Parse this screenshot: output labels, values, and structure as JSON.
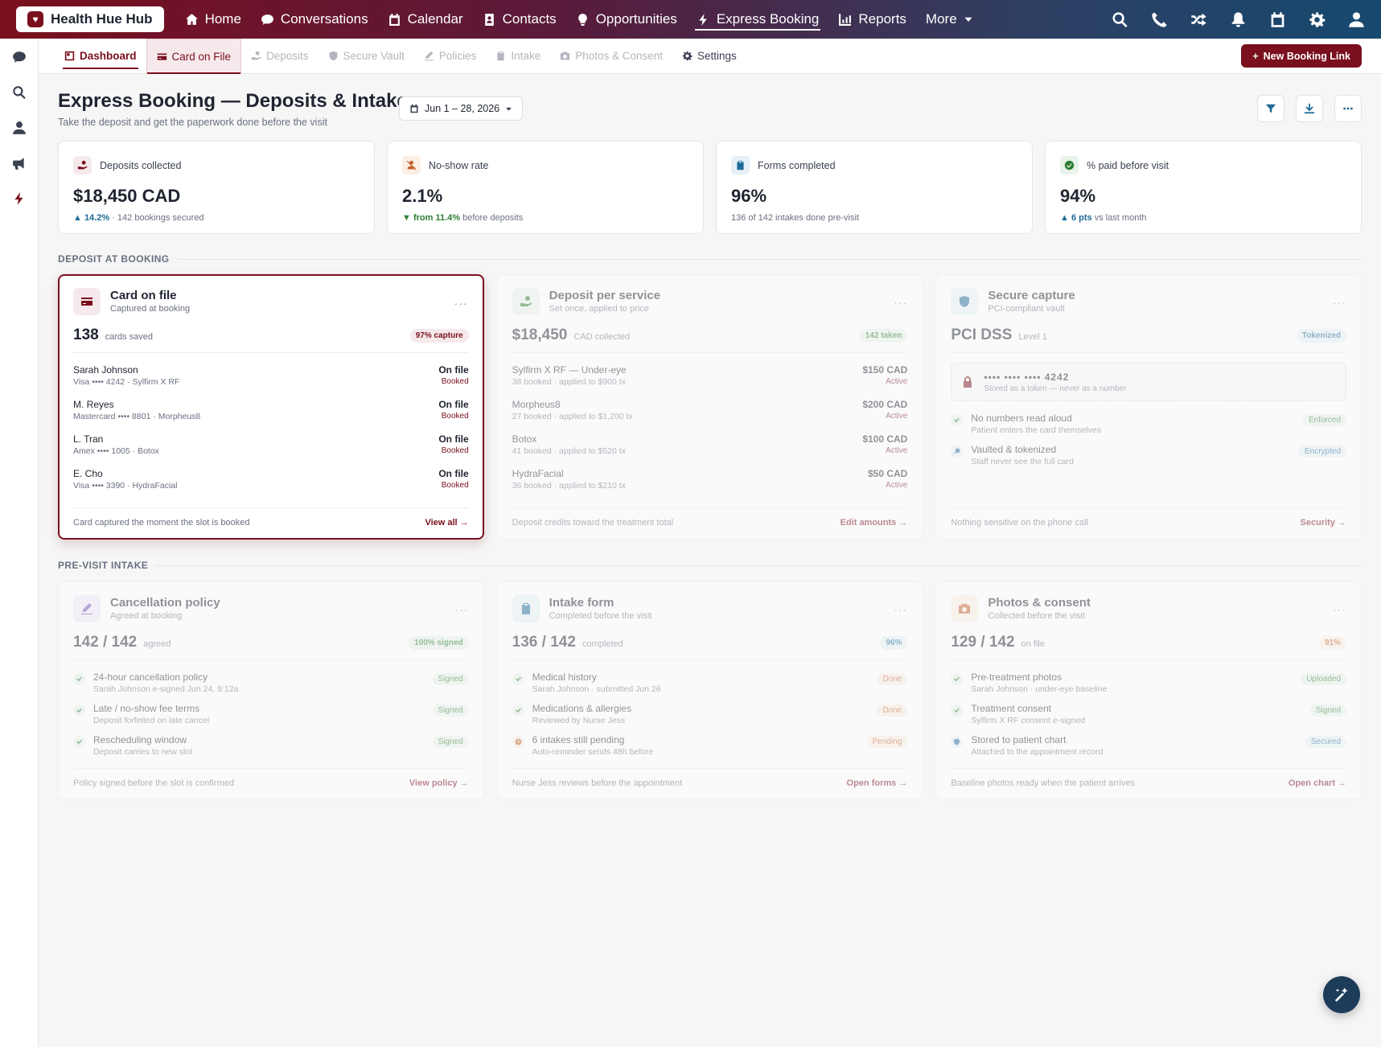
{
  "app": {
    "name": "Health Hue Hub"
  },
  "nav": {
    "items": [
      {
        "label": "Home",
        "icon": "home-icon"
      },
      {
        "label": "Conversations",
        "icon": "chat-icon"
      },
      {
        "label": "Calendar",
        "icon": "calendar-icon"
      },
      {
        "label": "Contacts",
        "icon": "contacts-icon"
      },
      {
        "label": "Opportunities",
        "icon": "lightbulb-icon"
      },
      {
        "label": "Express Booking",
        "icon": "bolt-icon",
        "active": true
      },
      {
        "label": "Reports",
        "icon": "bar-chart-icon"
      },
      {
        "label": "More",
        "icon": "caret-down-icon"
      }
    ],
    "right_icons": [
      "search-icon",
      "phone-icon",
      "shuffle-icon",
      "bell-icon",
      "calendar-icon",
      "gear-icon",
      "user-icon"
    ]
  },
  "rail": {
    "icons": [
      "chat-icon",
      "search-icon",
      "user-icon",
      "megaphone-icon",
      "bolt-icon"
    ]
  },
  "subnav": {
    "items": [
      {
        "label": "Dashboard",
        "icon": "dashboard-icon"
      },
      {
        "label": "Card on File",
        "icon": "card-icon"
      },
      {
        "label": "Deposits",
        "icon": "hand-coin-icon"
      },
      {
        "label": "Secure Vault",
        "icon": "shield-icon"
      },
      {
        "label": "Policies",
        "icon": "signature-icon"
      },
      {
        "label": "Intake",
        "icon": "clipboard-icon"
      },
      {
        "label": "Photos & Consent",
        "icon": "camera-icon"
      },
      {
        "label": "Settings",
        "icon": "gear-icon"
      }
    ],
    "new_button": "New Booking Link"
  },
  "page": {
    "title": "Express Booking — Deposits & Intake",
    "subtitle": "Take the deposit and get the paperwork done before the visit",
    "date_range": "Jun 1 – 28, 2026"
  },
  "kpis": [
    {
      "label": "Deposits collected",
      "value": "$18,450 CAD",
      "delta": "▲ 14.2%",
      "note": "· 142 bookings secured",
      "color": "#7a0f1e"
    },
    {
      "label": "No-show rate",
      "value": "2.1%",
      "delta": "▼ from 11.4%",
      "note": "before deposits",
      "color": "#c4622d"
    },
    {
      "label": "Forms completed",
      "value": "96%",
      "delta": "",
      "note": "136 of 142 intakes done pre-visit",
      "color": "#1e6a96"
    },
    {
      "label": "% paid before visit",
      "value": "94%",
      "delta": "▲ 6 pts",
      "note": "vs last month",
      "color": "#2e7d32"
    }
  ],
  "sections": {
    "deposit": "DEPOSIT AT BOOKING",
    "intake": "PRE-VISIT INTAKE"
  },
  "card_on_file": {
    "title": "Card on file",
    "subtitle": "Captured at booking",
    "stat": "138",
    "unit": "cards saved",
    "pill": "97% capture",
    "rows": [
      {
        "name": "Sarah Johnson",
        "detail": "Visa •••• 4242 · Sylfirm X RF",
        "value": "On file",
        "status": "Booked"
      },
      {
        "name": "M. Reyes",
        "detail": "Mastercard •••• 8801 · Morpheus8",
        "value": "On file",
        "status": "Booked"
      },
      {
        "name": "L. Tran",
        "detail": "Amex •••• 1005 · Botox",
        "value": "On file",
        "status": "Booked"
      },
      {
        "name": "E. Cho",
        "detail": "Visa •••• 3390 · HydraFacial",
        "value": "On file",
        "status": "Booked"
      }
    ],
    "footer": "Card captured the moment the slot is booked",
    "link": "View all →"
  },
  "deposit_per_service": {
    "title": "Deposit per service",
    "subtitle": "Set once, applied to price",
    "stat": "$18,450",
    "unit": "CAD collected",
    "pill": "142 taken",
    "rows": [
      {
        "name": "Sylfirm X RF — Under-eye",
        "detail": "38 booked · applied to $900 tx",
        "value": "$150 CAD",
        "status": "Active"
      },
      {
        "name": "Morpheus8",
        "detail": "27 booked · applied to $1,200 tx",
        "value": "$200 CAD",
        "status": "Active"
      },
      {
        "name": "Botox",
        "detail": "41 booked · applied to $520 tx",
        "value": "$100 CAD",
        "status": "Active"
      },
      {
        "name": "HydraFacial",
        "detail": "36 booked · applied to $210 tx",
        "value": "$50 CAD",
        "status": "Active"
      }
    ],
    "footer": "Deposit credits toward the treatment total",
    "link": "Edit amounts →"
  },
  "secure_capture": {
    "title": "Secure capture",
    "subtitle": "PCI-compliant vault",
    "stat": "PCI DSS",
    "unit": "Level 1",
    "pill": "Tokenized",
    "vault_number": "•••• •••• •••• 4242",
    "vault_note": "Stored as a token — never as a number",
    "features": [
      {
        "title": "No numbers read aloud",
        "detail": "Patient enters the card themselves",
        "tag": "Enforced"
      },
      {
        "title": "Vaulted & tokenized",
        "detail": "Staff never see the full card",
        "tag": "Encrypted"
      }
    ],
    "footer": "Nothing sensitive on the phone call",
    "link": "Security →"
  },
  "cancellation_policy": {
    "title": "Cancellation policy",
    "subtitle": "Agreed at booking",
    "stat": "142 / 142",
    "unit": "agreed",
    "pill": "100% signed",
    "features": [
      {
        "title": "24-hour cancellation policy",
        "detail": "Sarah Johnson e-signed Jun 24, 9:12a",
        "tag": "Signed"
      },
      {
        "title": "Late / no-show fee terms",
        "detail": "Deposit forfeited on late cancel",
        "tag": "Signed"
      },
      {
        "title": "Rescheduling window",
        "detail": "Deposit carries to new slot",
        "tag": "Signed"
      }
    ],
    "footer": "Policy signed before the slot is confirmed",
    "link": "View policy →"
  },
  "intake_form": {
    "title": "Intake form",
    "subtitle": "Completed before the visit",
    "stat": "136 / 142",
    "unit": "completed",
    "pill": "96%",
    "features": [
      {
        "title": "Medical history",
        "detail": "Sarah Johnson · submitted Jun 26",
        "tag": "Done"
      },
      {
        "title": "Medications & allergies",
        "detail": "Reviewed by Nurse Jess",
        "tag": "Done"
      },
      {
        "title": "6 intakes still pending",
        "detail": "Auto-reminder sends 48h before",
        "tag": "Pending"
      }
    ],
    "footer": "Nurse Jess reviews before the appointment",
    "link": "Open forms →"
  },
  "photos_consent": {
    "title": "Photos & consent",
    "subtitle": "Collected before the visit",
    "stat": "129 / 142",
    "unit": "on file",
    "pill": "91%",
    "features": [
      {
        "title": "Pre-treatment photos",
        "detail": "Sarah Johnson · under-eye baseline",
        "tag": "Uploaded"
      },
      {
        "title": "Treatment consent",
        "detail": "Sylfirm X RF consent e-signed",
        "tag": "Signed"
      },
      {
        "title": "Stored to patient chart",
        "detail": "Attached to the appointment record",
        "tag": "Secured"
      }
    ],
    "footer": "Baseline photos ready when the patient arrives",
    "link": "Open chart →"
  },
  "colors": {
    "brand": "#7a0f1e",
    "blue": "#1e6a96",
    "green": "#2e7d32",
    "orange": "#c4622d",
    "purple": "#7b4fb8"
  }
}
